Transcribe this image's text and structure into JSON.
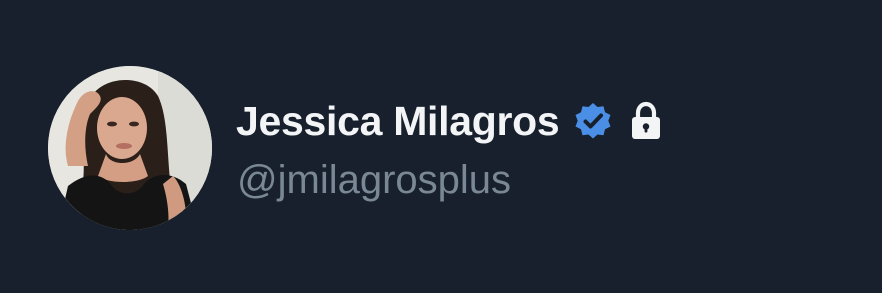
{
  "profile": {
    "display_name": "Jessica Milagros",
    "handle": "@jmilagrosplus",
    "verified": true,
    "protected": true,
    "avatar": "profile-photo"
  },
  "icons": {
    "verified": "verified-badge-icon",
    "lock": "lock-icon"
  },
  "colors": {
    "background": "#17202c",
    "name": "#f2f4f6",
    "handle": "#7a8795",
    "verified_badge": "#4a8ee6"
  }
}
